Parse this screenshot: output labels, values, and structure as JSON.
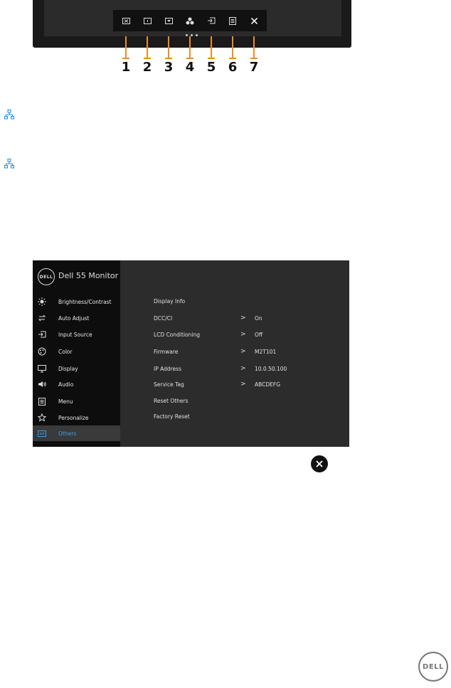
{
  "callouts": [
    "1",
    "2",
    "3",
    "4",
    "5",
    "6",
    "7"
  ],
  "osd": {
    "logo": "DELL",
    "title": "Dell 55 Monitor",
    "menu": [
      {
        "label": "Brightness/Contrast",
        "icon": "brightness-icon"
      },
      {
        "label": "Auto Adjust",
        "icon": "auto-adjust-icon"
      },
      {
        "label": "Input Source",
        "icon": "input-source-icon"
      },
      {
        "label": "Color",
        "icon": "color-icon"
      },
      {
        "label": "Display",
        "icon": "display-icon"
      },
      {
        "label": "Audio",
        "icon": "audio-icon"
      },
      {
        "label": "Menu",
        "icon": "menu-icon"
      },
      {
        "label": "Personalize",
        "icon": "personalize-icon"
      },
      {
        "label": "Others",
        "icon": "others-icon",
        "selected": true
      }
    ],
    "rows": [
      {
        "label": "Display Info",
        "chevron": "",
        "value": ""
      },
      {
        "label": "DCC/CI",
        "chevron": ">",
        "value": "On"
      },
      {
        "label": "LCD Conditioning",
        "chevron": ">",
        "value": "Off"
      },
      {
        "label": "Firmware",
        "chevron": ">",
        "value": "M2T101"
      },
      {
        "label": "IP Address",
        "chevron": ">",
        "value": "10.0.50.100"
      },
      {
        "label": "Service Tag",
        "chevron": ">",
        "value": "ABCDEFG"
      },
      {
        "label": "Reset Others",
        "chevron": "",
        "value": ""
      },
      {
        "label": "Factory Reset",
        "chevron": "",
        "value": ""
      }
    ]
  },
  "footer_logo": "DELL",
  "colors": {
    "accent": "#3aa0e8",
    "callout": "#f58a1f",
    "network_icon": "#1e88e5"
  }
}
